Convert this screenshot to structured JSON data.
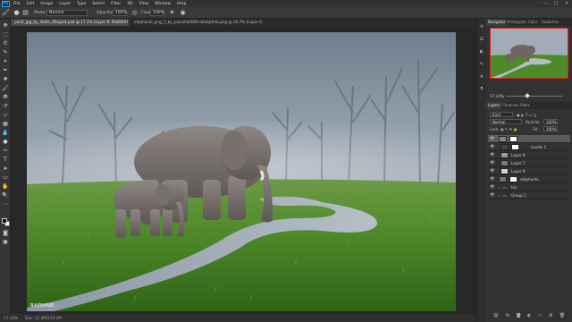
{
  "app": {
    "logo": "Ps"
  },
  "menu": [
    "File",
    "Edit",
    "Image",
    "Layer",
    "Type",
    "Select",
    "Filter",
    "3D",
    "View",
    "Window",
    "Help"
  ],
  "window_controls": {
    "minimize": "—",
    "maximize": "□",
    "close": "✕"
  },
  "options": {
    "mode_label": "Mode:",
    "mode_value": "Normal",
    "opacity_label": "Opacity:",
    "opacity_value": "100%",
    "flow_label": "Flow:",
    "flow_value": "100%"
  },
  "tabs": [
    {
      "label": "point_jpg_by_liadie_d5ajyk4.psd @ 17.3% (Layer 9, RGB/8#) *",
      "active": true
    },
    {
      "label": "elephants_png_1_by_jeanvilo0009-d4abpfmb.png @ 16.7% (Layer 0, RGB/8#)",
      "active": false
    }
  ],
  "status": {
    "zoom": "17.14%",
    "doc": "Doc: 11.4M/115.2M"
  },
  "navigator": {
    "tabs": [
      "Navigator",
      "Histogram",
      "Color",
      "Swatches"
    ],
    "zoom": "17.14%"
  },
  "layers_panel": {
    "tabs": [
      "Layers",
      "Channels",
      "Paths"
    ],
    "kind_label": "Kind",
    "blend_mode": "Normal",
    "opacity_label": "Opacity:",
    "opacity_value": "100%",
    "lock_label": "Lock:",
    "fill_label": "Fill:",
    "fill_value": "100%",
    "layers": [
      {
        "name": "",
        "active": true
      },
      {
        "name": "Levels 1",
        "active": false
      },
      {
        "name": "Layer 8",
        "active": false
      },
      {
        "name": "Layer 7",
        "active": false
      },
      {
        "name": "Layer 9",
        "active": false
      },
      {
        "name": "elephants",
        "active": false
      },
      {
        "name": "bin",
        "active": false
      },
      {
        "name": "Group 1",
        "active": false
      }
    ]
  },
  "watermark": "RAFAYABI"
}
